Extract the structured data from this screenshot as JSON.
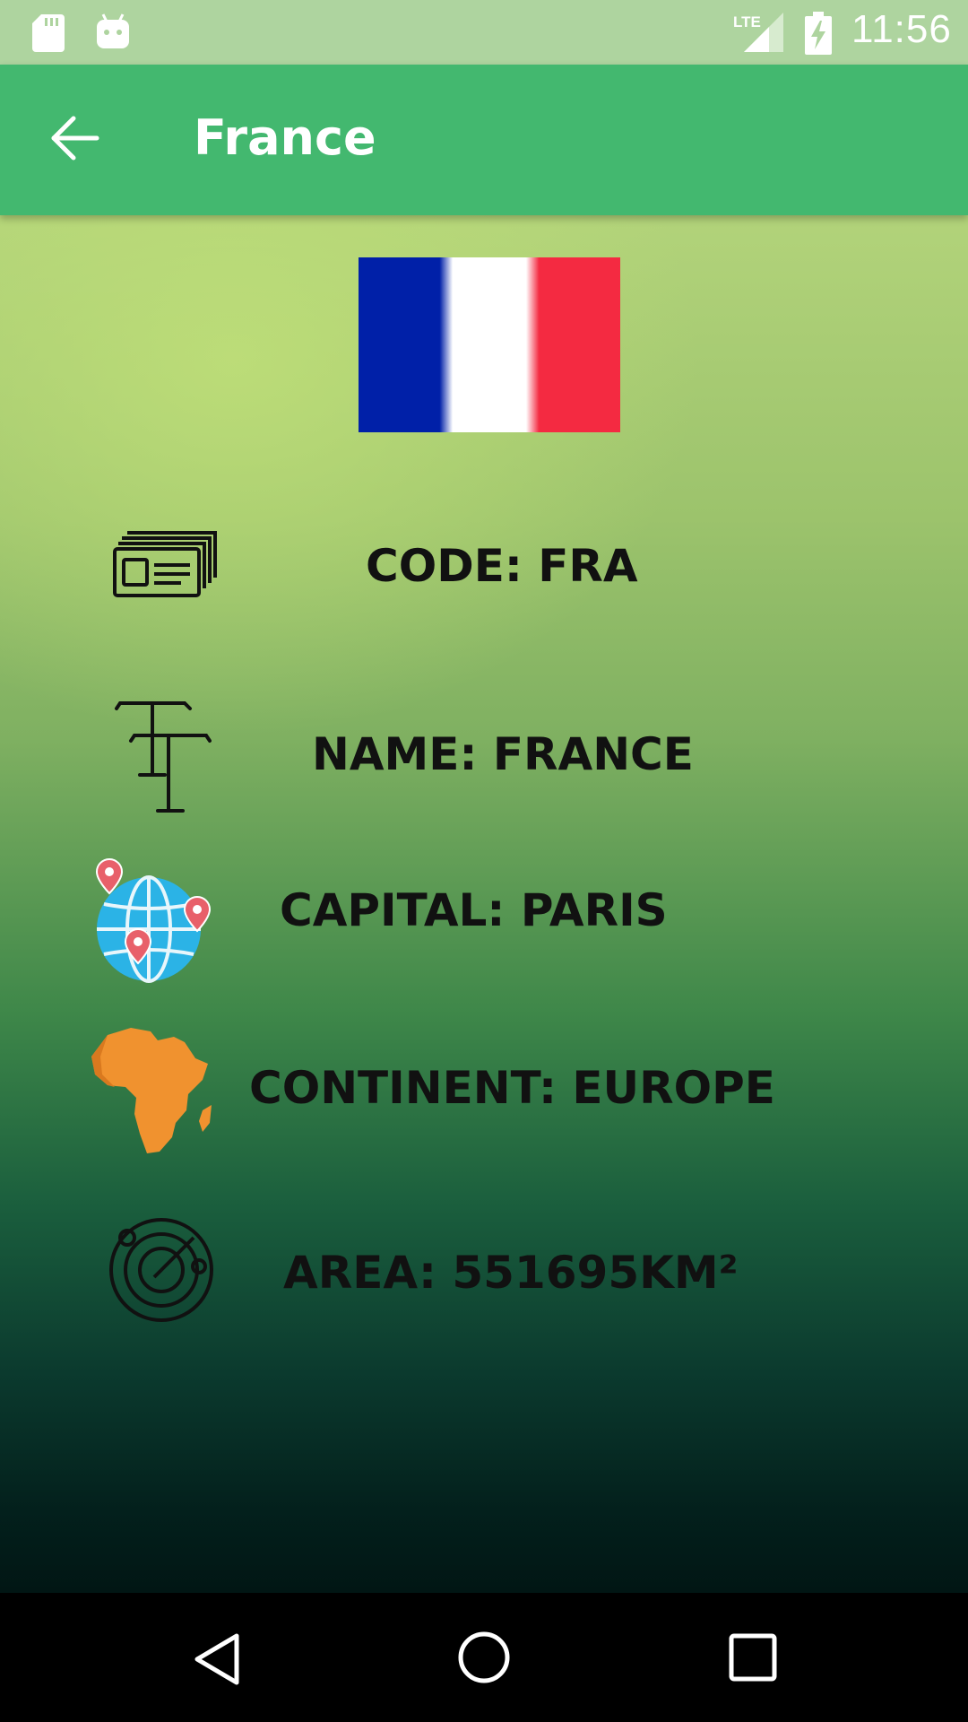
{
  "status_bar": {
    "time": "11:56",
    "network": "LTE",
    "icons": [
      "sd-card-icon",
      "android-icon",
      "lte-signal-icon",
      "battery-charging-icon"
    ]
  },
  "app_bar": {
    "title": "France",
    "back_icon": "arrow-back-icon",
    "color": "#43b86f"
  },
  "flag": {
    "country": "France",
    "colors": [
      "#0020a8",
      "#ffffff",
      "#f42a41"
    ]
  },
  "details": [
    {
      "icon": "id-card-icon",
      "label": "CODE: FRA"
    },
    {
      "icon": "text-type-icon",
      "label": "NAME: FRANCE"
    },
    {
      "icon": "globe-pins-icon",
      "label": "CAPITAL: PARIS"
    },
    {
      "icon": "africa-map-icon",
      "label": "CONTINENT: EUROPE"
    },
    {
      "icon": "radar-icon",
      "label": "AREA: 551695KM²"
    }
  ],
  "nav_bar": {
    "buttons": [
      "back-triangle-icon",
      "home-circle-icon",
      "recents-square-icon"
    ]
  }
}
